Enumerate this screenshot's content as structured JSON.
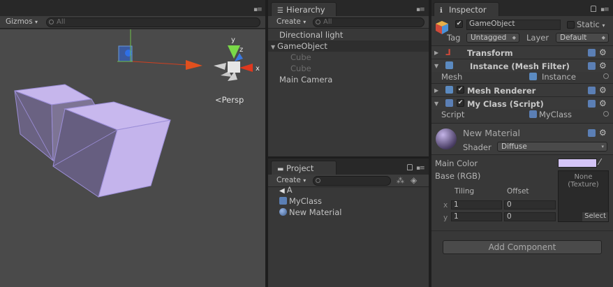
{
  "scene": {
    "gizmos_label": "Gizmos",
    "gizmos_arrow": "▾",
    "search_placeholder": "All",
    "persp_label": "Persp",
    "persp_arrow": "<",
    "axis_x": "x",
    "axis_y": "y",
    "axis_z": "z"
  },
  "hierarchy": {
    "tab_label": "Hierarchy",
    "create_label": "Create",
    "create_arrow": "▾",
    "search_placeholder": "All",
    "items": [
      {
        "label": "Directional light"
      },
      {
        "label": "GameObject"
      },
      {
        "label": "Cube"
      },
      {
        "label": "Cube"
      },
      {
        "label": "Main Camera"
      }
    ],
    "expand_arrow": "▼"
  },
  "project": {
    "tab_label": "Project",
    "create_label": "Create",
    "create_arrow": "▾",
    "items": [
      {
        "label": "A"
      },
      {
        "label": "MyClass"
      },
      {
        "label": "New Material"
      }
    ]
  },
  "inspector": {
    "tab_label": "Inspector",
    "object_name": "GameObject",
    "static_label": "Static",
    "static_arrow": "▾",
    "tag_label": "Tag",
    "tag_value": "Untagged",
    "layer_label": "Layer",
    "layer_value": "Default",
    "transform_label": "Transform",
    "mesh_filter_label": "Instance (Mesh Filter)",
    "mesh_label": "Mesh",
    "mesh_value": "Instance",
    "mesh_renderer_label": "Mesh Renderer",
    "script_comp_label": "My Class (Script)",
    "script_label": "Script",
    "script_value": "MyClass",
    "material_name": "New Material",
    "shader_label": "Shader",
    "shader_value": "Diffuse",
    "main_color_label": "Main Color",
    "base_label": "Base (RGB)",
    "texture_none": "None",
    "texture_type": "(Texture)",
    "tiling_label": "Tiling",
    "offset_label": "Offset",
    "x_label": "x",
    "y_label": "y",
    "tiling_x": "1",
    "tiling_y": "1",
    "offset_x": "0",
    "offset_y": "0",
    "select_label": "Select",
    "add_component_label": "Add Component",
    "main_color": "#d4c4f6"
  }
}
